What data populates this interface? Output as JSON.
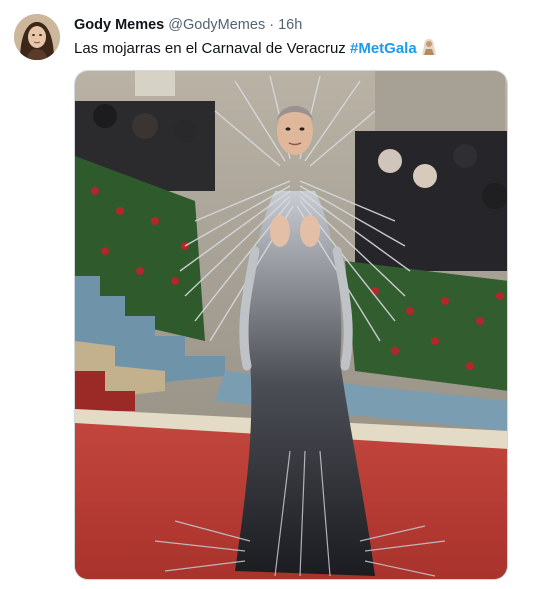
{
  "tweet": {
    "display_name": "Gody Memes",
    "handle": "@GodyMemes",
    "separator": "·",
    "time": "16h",
    "text": "Las mojarras en el Carnaval de Veracruz ",
    "hashtag": "#MetGala",
    "emoji_icon": "person-with-veil-emoji"
  },
  "media": {
    "description_icon": "photo"
  },
  "colors": {
    "hashtag": "#1d9bf0",
    "secondary_text": "#536471",
    "carpet": "#b73a33"
  }
}
